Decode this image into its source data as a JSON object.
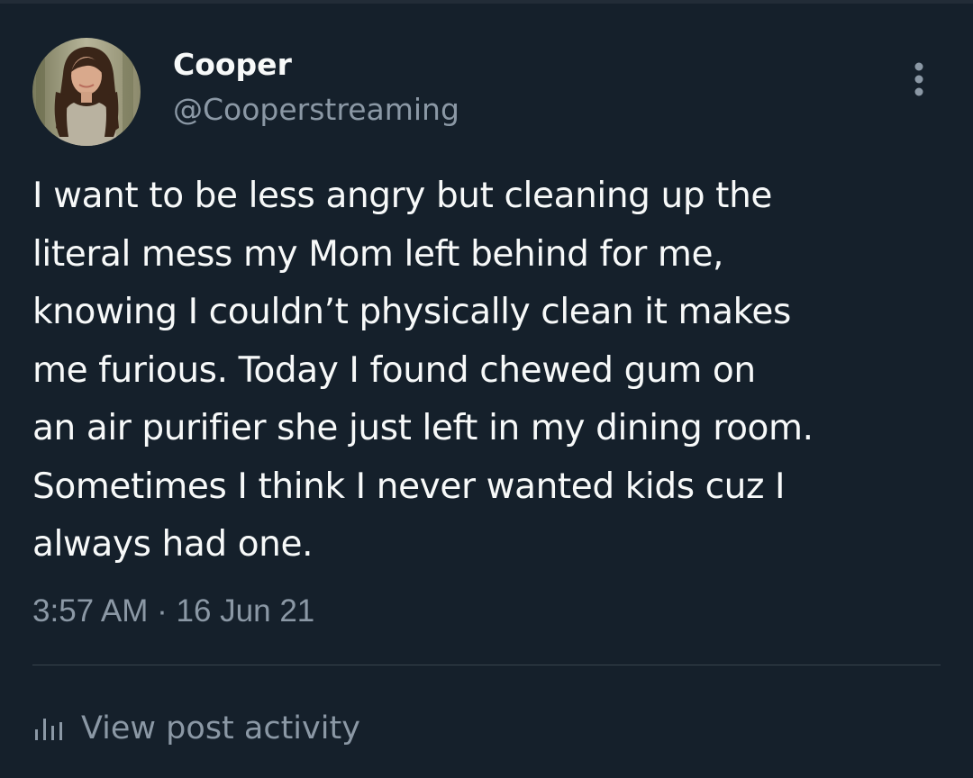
{
  "tweet": {
    "author": {
      "display_name": "Cooper",
      "handle": "@Cooperstreaming",
      "avatar": "profile-photo"
    },
    "more_icon": "more-vertical-icon",
    "text_lines": [
      "I want to be less angry but cleaning up the",
      "literal mess my Mom left behind for me,",
      "knowing I couldn’t physically clean it makes",
      "me furious. Today I found chewed gum on",
      "an air purifier she just left in my dining room.",
      "Sometimes I think I never wanted kids cuz I",
      "always had one."
    ],
    "timestamp": "3:57 AM · 16 Jun 21",
    "activity": {
      "icon": "bar-chart-icon",
      "label": "View post activity"
    }
  },
  "colors": {
    "background": "#15202b",
    "primary_text": "#f7f9f9",
    "secondary_text": "#8b98a5",
    "divider": "#38444d"
  }
}
